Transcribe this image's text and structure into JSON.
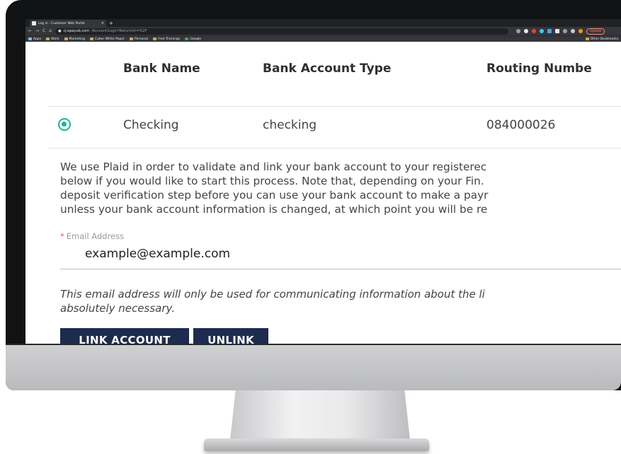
{
  "browser": {
    "tab_title": "Log in - Customer Web Portal",
    "tab_close": "×",
    "new_tab": "+",
    "url_host": "cj.epayub.com",
    "url_path": "/Account/Login?ReturnUrl=%2F",
    "update_label": "Update",
    "bookmarks": [
      "Apps",
      "Work",
      "Marketing",
      "Cyber White Paper",
      "Personal",
      "Free Trainings",
      "Google"
    ],
    "other_bookmarks": "Other Bookmarks"
  },
  "table": {
    "headers": [
      "Bank Name",
      "Bank Account Type",
      "Routing Numbe"
    ],
    "row": {
      "bank_name": "Checking",
      "account_type": "checking",
      "routing_number": "084000026"
    }
  },
  "info_lines": [
    "We use Plaid in order to validate and link your bank account to your registerec",
    "below if you would like to start this process. Note that, depending on your Fin.",
    "deposit verification step before you can use your bank account to make a payr",
    "unless your bank account information is changed, at which point you will be re"
  ],
  "email": {
    "required_mark": "*",
    "label": "Email Address",
    "value": "example@example.com"
  },
  "note_lines": [
    "This email address will only be used for communicating information about the li",
    "absolutely necessary."
  ],
  "buttons": {
    "link": "LINK ACCOUNT",
    "unlink": "UNLINK"
  },
  "colors": {
    "accent_teal": "#1db398",
    "button_navy": "#1d2b4f"
  }
}
